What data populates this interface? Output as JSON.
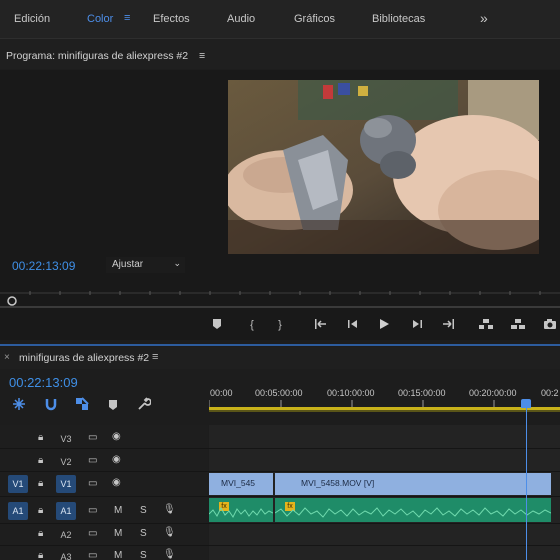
{
  "workspace_tabs": {
    "edicion": "Edición",
    "color": "Color",
    "efectos": "Efectos",
    "audio": "Audio",
    "graficos": "Gráficos",
    "bibliotecas": "Bibliotecas",
    "more": "»"
  },
  "program_monitor": {
    "title": "Programa: minifiguras de aliexpress #2",
    "menu_icon": "≡",
    "timecode": "00:22:13:09",
    "fit_value": "Ajustar"
  },
  "timeline": {
    "close": "×",
    "title": "minifiguras de aliexpress #2",
    "menu_icon": "≡",
    "timecode": "00:22:13:09",
    "ruler_labels": [
      "00:00",
      "00:05:00:00",
      "00:10:00:00",
      "00:15:00:00",
      "00:20:00:00",
      "00:2"
    ],
    "tracks": [
      {
        "source": "",
        "name": "V3"
      },
      {
        "source": "",
        "name": "V2"
      },
      {
        "source": "V1",
        "name": "V1"
      },
      {
        "source": "A1",
        "name": "A1",
        "m": "M",
        "s": "S"
      },
      {
        "source": "",
        "name": "A2",
        "m": "M",
        "s": "S"
      },
      {
        "source": "",
        "name": "A3",
        "m": "M",
        "s": "S"
      }
    ],
    "clips": {
      "v1_clip1": "MVI_545",
      "v1_clip2": "MVI_5458.MOV [V]",
      "fx": "fx"
    }
  },
  "colors": {
    "accent": "#4d8ee8",
    "video_clip": "#8fb0e0",
    "audio_clip": "#1f8c68",
    "fx_badge": "#e4b41c"
  }
}
